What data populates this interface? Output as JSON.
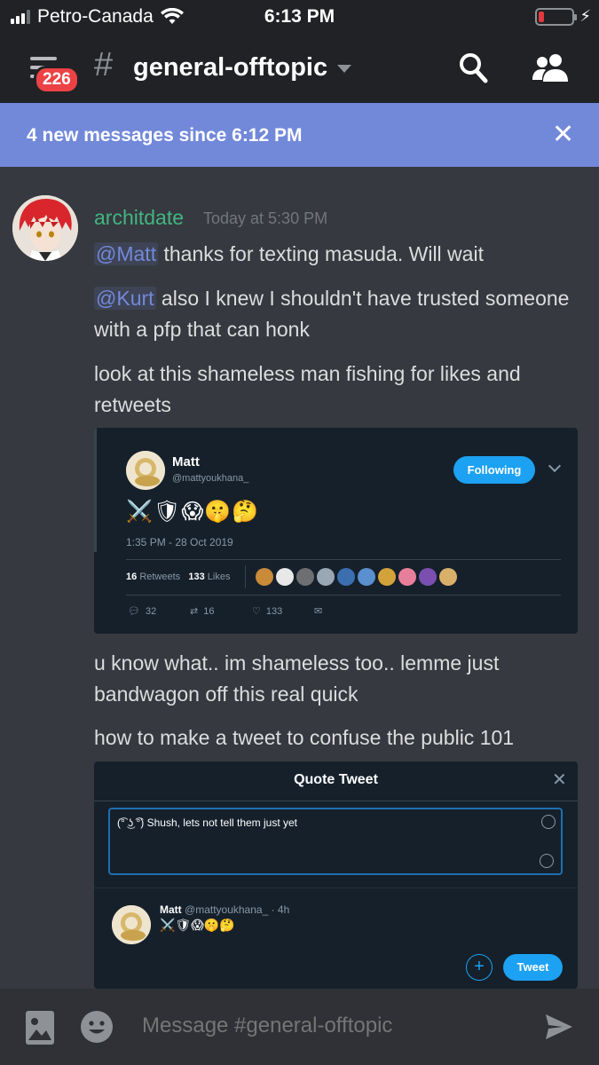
{
  "status_bar": {
    "carrier": "Petro-Canada",
    "time": "6:13 PM"
  },
  "header": {
    "unread_badge": "226",
    "channel_name": "general-offtopic"
  },
  "new_messages_bar": {
    "text": "4 new messages since 6:12 PM"
  },
  "message": {
    "author": "architdate",
    "timestamp": "Today at 5:30 PM",
    "author_color": "#43b581",
    "lines": [
      {
        "mention": "@Matt",
        "text": " thanks for texting masuda. Will wait"
      },
      {
        "mention": "@Kurt",
        "text": " also I knew I shouldn't have trusted someone with a pfp that can honk"
      },
      {
        "text": "look at this shameless man fishing for likes and retweets"
      },
      {
        "text": "u know what.. im shameless too.. lemme just bandwagon off this real quick"
      },
      {
        "text": "how to make a tweet to confuse the public 101"
      }
    ]
  },
  "tweet_embed": {
    "name": "Matt",
    "handle": "@mattyoukhana_",
    "follow_label": "Following",
    "emojis": "⚔️🛡😱🤫🤔",
    "date": "1:35 PM - 28 Oct 2019",
    "retweets_count": "16",
    "retweets_label": "Retweets",
    "likes_count": "133",
    "likes_label": "Likes",
    "reply_count": "32",
    "retweet_action_count": "16",
    "like_action_count": "133"
  },
  "quote_embed": {
    "title": "Quote Tweet",
    "input_text": "(͡° ͜ʖ ͡°) Shush, lets not tell them just yet",
    "quoted_name": "Matt",
    "quoted_handle": "@mattyoukhana_ · 4h",
    "quoted_emojis": "⚔️🛡😱🤫🤔",
    "tweet_button": "Tweet",
    "plus": "+"
  },
  "composer": {
    "placeholder": "Message #general-offtopic"
  },
  "colors": {
    "accent": "#7289da",
    "background": "#36393f",
    "header": "#202225",
    "twitter_blue": "#1da1f2"
  }
}
